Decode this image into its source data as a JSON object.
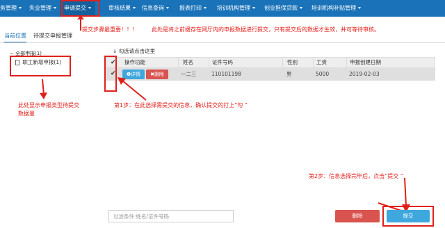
{
  "nav": {
    "items": [
      {
        "label": "务管理"
      },
      {
        "label": "失业管理"
      },
      {
        "label": "申请提交"
      },
      {
        "label": "审核结果"
      },
      {
        "label": "信息查询"
      },
      {
        "label": "报表打印"
      },
      {
        "label": "培训机构管理"
      },
      {
        "label": "创业担保贷款"
      },
      {
        "label": "培训机构补贴管理"
      }
    ],
    "active_index": 2
  },
  "annotations": {
    "top_note_1": "提交步骤最重要！！！",
    "top_note_2": "此处是将之前缓存在网厅内的申报数据进行提交，只有提交后的数据才生效，并可等待审核。",
    "left_note_line1": "此处显示申报类型待提交",
    "left_note_line2": "数据量",
    "step1": "第1步：在此选择需提交的信息，确认提交的打上”勾 “",
    "step2": "第2步：信息选择完毕后，点击”提交 “"
  },
  "tabs": {
    "current": "当前位置",
    "pending": "待提交申报管理"
  },
  "tree": {
    "root": "全部申报(1)",
    "child": "职工新增申报(1)"
  },
  "table": {
    "check_hint": "勾选请点击这里",
    "headers": [
      "",
      "操作功能",
      "姓名",
      "证件号码",
      "性别",
      "工资",
      "申报创建日期"
    ],
    "rows": [
      {
        "checked": "✔",
        "detail_label": "详情",
        "delete_label": "删除",
        "name": "一二三",
        "id_number": "110101198",
        "gender": "男",
        "salary": "5000",
        "date": "2019-02-03"
      }
    ]
  },
  "bottom": {
    "filter_placeholder": "过滤条件:姓名/证件号码",
    "delete_label": "删除",
    "submit_label": "提交"
  },
  "colors": {
    "nav_bg": "#1a73b8",
    "annotation_red": "#e0201b",
    "primary_button": "#3ea7dd",
    "danger_button": "#d9534f"
  }
}
